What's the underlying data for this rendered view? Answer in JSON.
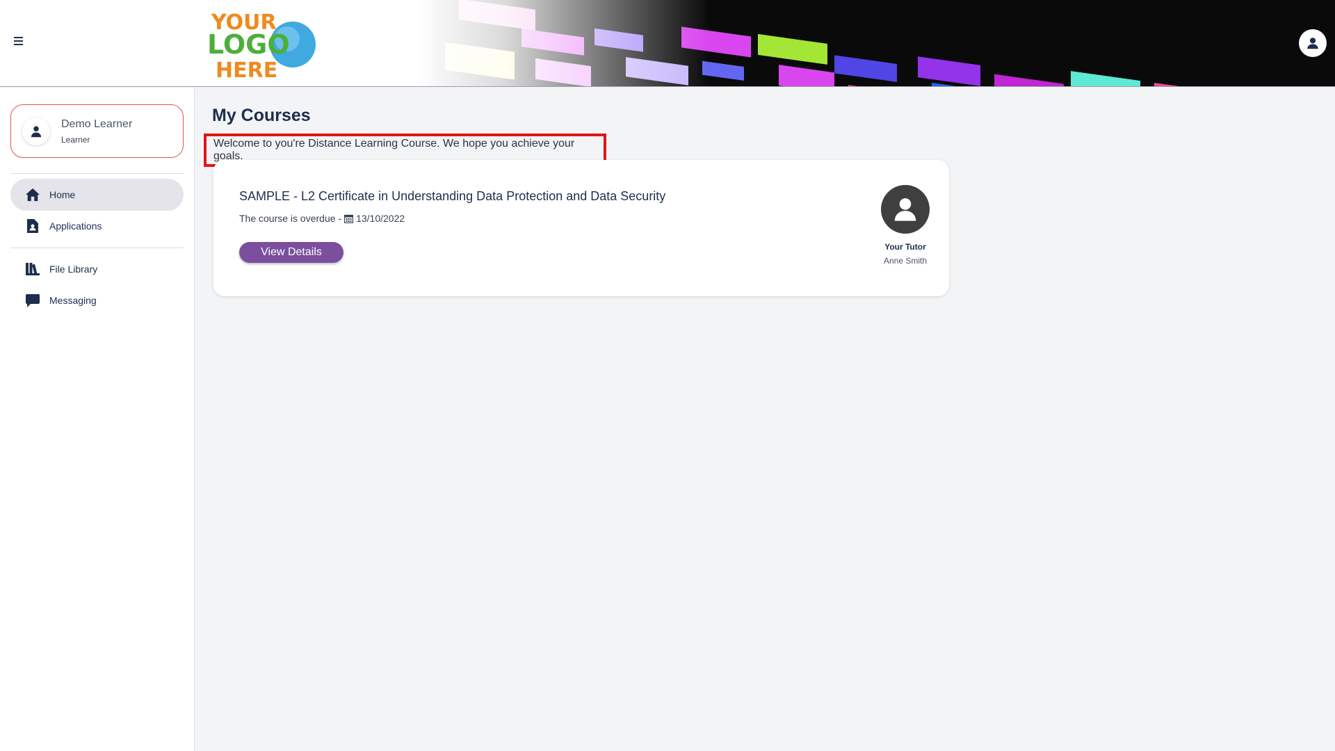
{
  "header": {
    "menu_icon": "hamburger-icon",
    "logo": {
      "line1": "YOUR",
      "line2": "LOGO",
      "line3": "HERE"
    },
    "account_icon": "user-circle-icon"
  },
  "sidebar": {
    "user": {
      "name": "Demo Learner",
      "role": "Learner",
      "icon": "user-icon"
    },
    "nav_primary": [
      {
        "label": "Home",
        "icon": "home-icon",
        "active": true
      },
      {
        "label": "Applications",
        "icon": "document-user-icon",
        "active": false
      }
    ],
    "nav_secondary": [
      {
        "label": "File Library",
        "icon": "books-icon",
        "active": false
      },
      {
        "label": "Messaging",
        "icon": "message-icon",
        "active": false
      }
    ]
  },
  "main": {
    "title": "My Courses",
    "welcome": "Welcome to you're Distance Learning Course. We hope you achieve your goals.",
    "course": {
      "title": "SAMPLE - L2 Certificate in Understanding Data Protection and Data Security",
      "status_text": "The course is overdue -",
      "due_date": "13/10/2022",
      "button_label": "View Details",
      "tutor_label": "Your Tutor",
      "tutor_name": "Anne Smith"
    }
  },
  "colors": {
    "primary_text": "#1f2d4d",
    "accent_purple": "#7b4f9e",
    "highlight_red": "#e01616",
    "card_border_red": "#e0524c",
    "logo_orange": "#ef8a1e",
    "logo_green": "#4caf3a",
    "logo_blue": "#3fa9e0"
  }
}
